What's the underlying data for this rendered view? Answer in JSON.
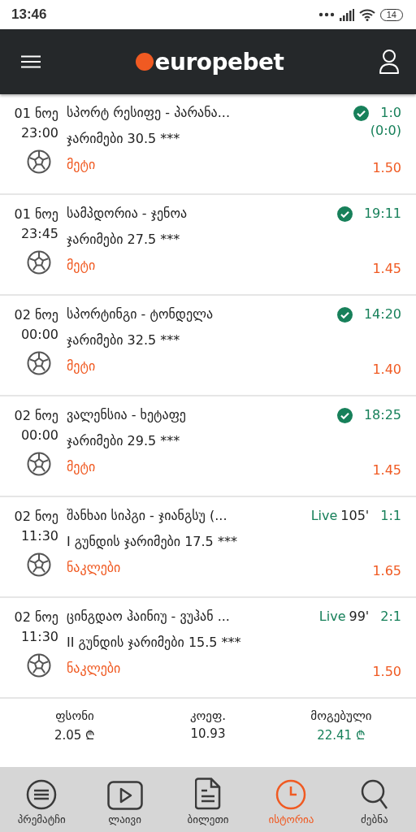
{
  "status_bar": {
    "time": "13:46",
    "battery": "14"
  },
  "header": {
    "logo": "europebet"
  },
  "bets": [
    {
      "date": "01 ნოე",
      "time": "23:00",
      "match": "სპორტ რესიფე - პარანა...",
      "market": "ჯარიმები 30.5 ***",
      "pick": "მეტი",
      "status": {
        "kind": "won"
      },
      "result": "1:0",
      "result_extra": "(0:0)",
      "odds": "1.50"
    },
    {
      "date": "01 ნოე",
      "time": "23:45",
      "match": "სამპდორია - ჯენოა",
      "market": "ჯარიმები 27.5 ***",
      "pick": "მეტი",
      "status": {
        "kind": "won"
      },
      "result": "19:11",
      "odds": "1.45"
    },
    {
      "date": "02 ნოე",
      "time": "00:00",
      "match": "სპორტინგი - ტონდელა",
      "market": "ჯარიმები 32.5 ***",
      "pick": "მეტი",
      "status": {
        "kind": "won"
      },
      "result": "14:20",
      "odds": "1.40"
    },
    {
      "date": "02 ნოე",
      "time": "00:00",
      "match": "ვალენსია - ხეტაფე",
      "market": "ჯარიმები 29.5 ***",
      "pick": "მეტი",
      "status": {
        "kind": "won"
      },
      "result": "18:25",
      "odds": "1.45"
    },
    {
      "date": "02 ნოე",
      "time": "11:30",
      "match": "შანხაი სიპგი - ჯიანგსუ (...",
      "market": "I გუნდის ჯარიმები 17.5 ***",
      "pick": "ნაკლები",
      "status": {
        "kind": "live",
        "label": "Live",
        "minute": "105'"
      },
      "result": "1:1",
      "odds": "1.65"
    },
    {
      "date": "02 ნოე",
      "time": "11:30",
      "match": "ცინგდაო ჰაინიუ - ვუჰან ...",
      "market": "II გუნდის ჯარიმები 15.5 ***",
      "pick": "ნაკლები",
      "status": {
        "kind": "live",
        "label": "Live",
        "minute": "99'"
      },
      "result": "2:1",
      "odds": "1.50"
    }
  ],
  "summary": [
    {
      "label": "ფსონი",
      "value": "2.05 ₾",
      "kind": "plain"
    },
    {
      "label": "კოეფ.",
      "value": "10.93",
      "kind": "plain"
    },
    {
      "label": "მოგებული",
      "value": "22.41 ₾",
      "kind": "win"
    }
  ],
  "nav": [
    {
      "label": "პრემატჩი",
      "kind": "prematch",
      "selected": false
    },
    {
      "label": "ლაივი",
      "kind": "live",
      "selected": false
    },
    {
      "label": "ბილეთი",
      "kind": "ticket",
      "selected": false
    },
    {
      "label": "ისტორია",
      "kind": "history",
      "selected": true
    },
    {
      "label": "ძებნა",
      "kind": "search",
      "selected": false
    }
  ]
}
